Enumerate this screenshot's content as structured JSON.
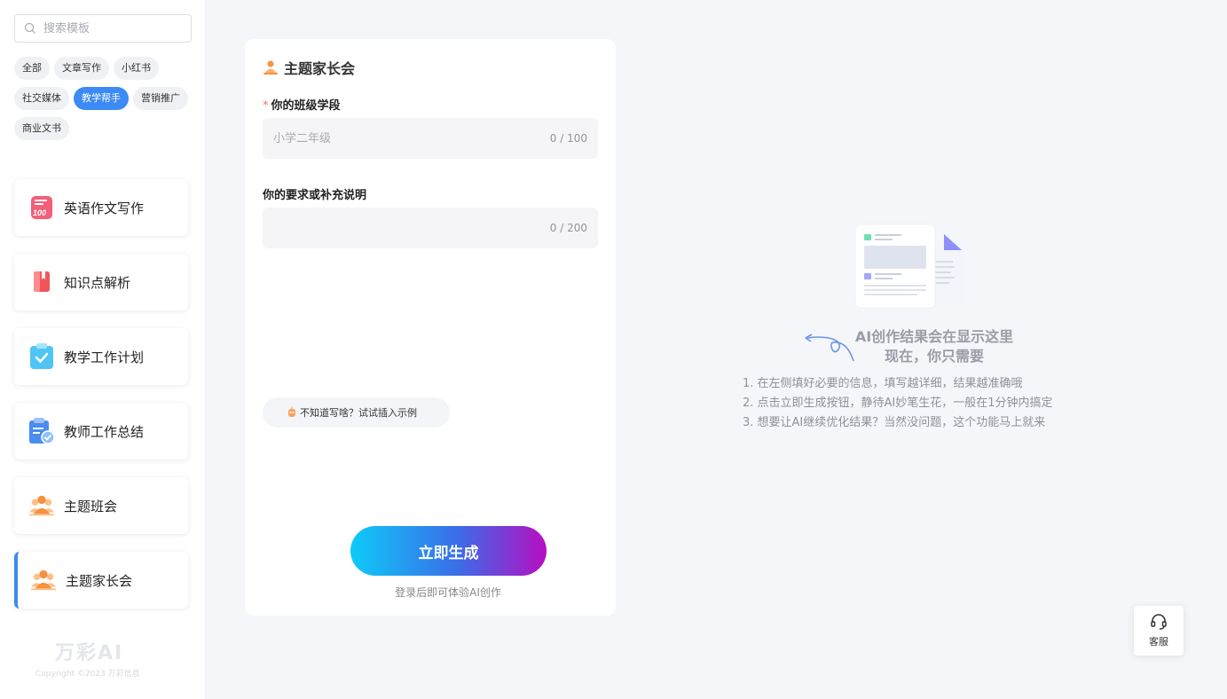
{
  "sidebar": {
    "search_placeholder": "搜索模板",
    "tags": [
      "全部",
      "文章写作",
      "小红书",
      "社交媒体",
      "教学帮手",
      "营销推广",
      "商业文书"
    ],
    "active_tag": "教学帮手",
    "cards": [
      {
        "label": "英语作文写作",
        "icon": "score-paper-icon"
      },
      {
        "label": "知识点解析",
        "icon": "book-icon"
      },
      {
        "label": "教学工作计划",
        "icon": "clipboard-check-icon"
      },
      {
        "label": "教师工作总结",
        "icon": "clipboard-badge-icon"
      },
      {
        "label": "主题班会",
        "icon": "people-icon"
      },
      {
        "label": "主题家长会",
        "icon": "people-icon"
      }
    ],
    "active_card": "主题家长会",
    "brand": "万彩AI",
    "copyright": "Copyright ©2023 万彩信息"
  },
  "form": {
    "title": "主题家长会",
    "field1": {
      "required_mark": "*",
      "label": "你的班级学段",
      "placeholder": "小学二年级",
      "value": "",
      "count": "0 / 100"
    },
    "field2": {
      "label": "你的要求或补充说明",
      "placeholder": "",
      "value": "",
      "count": "0 / 200"
    },
    "example_label": "不知道写啥？试试插入示例",
    "generate_label": "立即生成",
    "login_hint": "登录后即可体验AI创作"
  },
  "empty_state": {
    "title_line1": "AI创作结果会在显示这里",
    "title_line2": "现在，你只需要",
    "steps": [
      "1. 在左侧填好必要的信息，填写越详细，结果越准确哦",
      "2. 点击立即生成按钮，静待AI妙笔生花，一般在1分钟内搞定",
      "3. 想要让AI继续优化结果？当然没问题，这个功能马上就来"
    ]
  },
  "service": {
    "label": "客服"
  },
  "colors": {
    "accent": "#3b8af5",
    "page_bg": "#f5f6fa",
    "required": "#f56c6c"
  }
}
